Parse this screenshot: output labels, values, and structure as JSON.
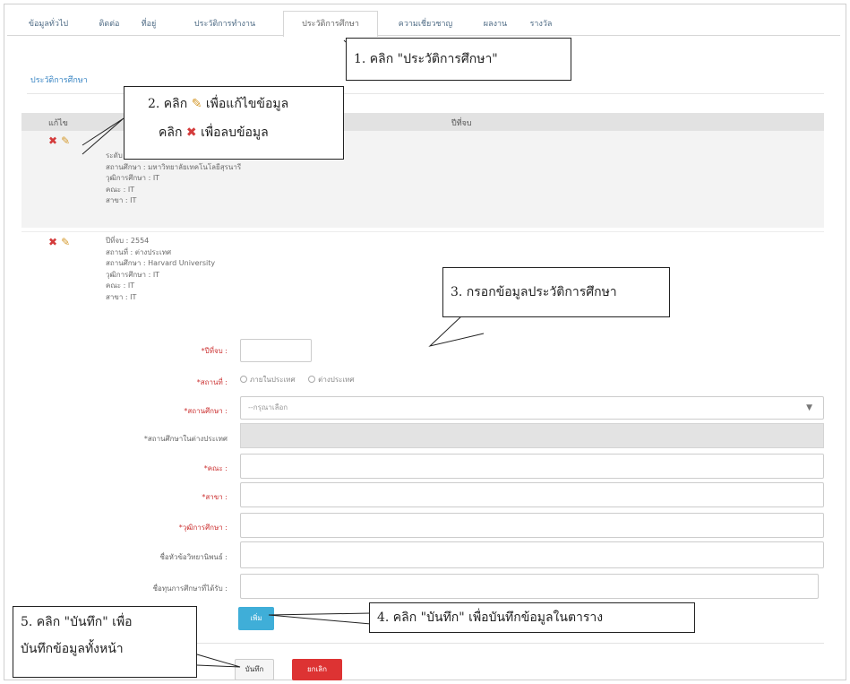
{
  "tabs": [
    {
      "label": "ข้อมูลทั่วไป"
    },
    {
      "label": "ติดต่อ"
    },
    {
      "label": "ที่อยู่"
    },
    {
      "label": "ประวัติการทำงาน"
    },
    {
      "label": "ประวัติการศึกษา",
      "active": true
    },
    {
      "label": "ความเชี่ยวชาญ"
    },
    {
      "label": "ผลงาน"
    },
    {
      "label": "รางวัล"
    }
  ],
  "section_title": "ประวัติการศึกษา",
  "table": {
    "col_manage": "แก้ไข",
    "col_year": "ปีที่จบ",
    "rows": [
      {
        "lines": [
          "ระดับ : ปริญญาโท",
          "สถานศึกษา : มหาวิทยาลัยเทคโนโลยีสุรนารี",
          "วุฒิการศึกษา : IT",
          "คณะ : IT",
          "สาขา : IT"
        ]
      },
      {
        "lines": [
          "ปีที่จบ : 2554",
          "สถานที่ : ต่างประเทศ",
          "สถานศึกษา : Harvard University",
          "วุฒิการศึกษา : IT",
          "คณะ : IT",
          "สาขา : IT"
        ]
      }
    ]
  },
  "form": {
    "year_label": "*ปีที่จบ :",
    "location_label": "*สถานที่ :",
    "location_options": [
      "ภายในประเทศ",
      "ต่างประเทศ"
    ],
    "institute_label": "*สถานศึกษา :",
    "institute_placeholder": "--กรุณาเลือก",
    "foreign_institute_label": "*สถานศึกษาในต่างประเทศ",
    "faculty_label": "*คณะ :",
    "major_label": "*สาขา :",
    "degree_label": "*วุฒิการศึกษา :",
    "thesis_label": "ชื่อหัวข้อวิทยานิพนธ์ :",
    "scholarship_label": "ชื่อทุนการศึกษาที่ได้รับ :"
  },
  "buttons": {
    "add": "เพิ่ม",
    "save": "บันทึก",
    "cancel": "ยกเลิก"
  },
  "callouts": {
    "step1": "1. คลิก \"ประวัติการศึกษา\"",
    "step2_a": "2. คลิก",
    "step2_b": "เพื่อแก้ไขข้อมูล",
    "step2_c": "คลิก",
    "step2_d": "เพื่อลบข้อมูล",
    "step3": "3. กรอกข้อมูลประวัติการศึกษา",
    "step4": "4. คลิก \"บันทึก\" เพื่อบันทึกข้อมูลในตาราง",
    "step5_a": "5. คลิก \"บันทึก\" เพื่อ",
    "step5_b": "บันทึกข้อมูลทั้งหน้า"
  },
  "colors": {
    "accent_blue": "#3faed8",
    "danger_red": "#dd3333",
    "edit_orange": "#d59a2e"
  }
}
